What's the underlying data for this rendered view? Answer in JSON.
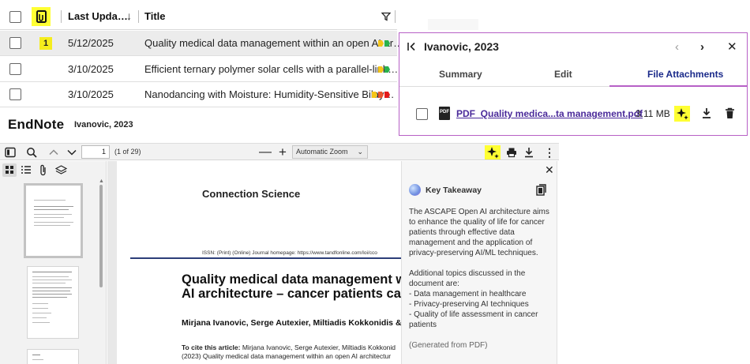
{
  "table": {
    "headers": {
      "last_updated": "Last Upda…",
      "title": "Title"
    },
    "rows": [
      {
        "badge": "1",
        "date": "5/12/2025",
        "title": "Quality medical data management within an open AI ar…",
        "tag_colors": [
          "#f5c518",
          "#2bb24c"
        ]
      },
      {
        "badge": "",
        "date": "3/10/2025",
        "title": "Efficient ternary polymer solar cells with a parallel-link…",
        "tag_colors": [
          "#f5c518",
          "#2bb24c"
        ]
      },
      {
        "badge": "",
        "date": "3/10/2025",
        "title": "Nanodancing with Moisture: Humidity-Sensitive Bilay…",
        "tag_colors": [
          "#f5c518",
          "#e8542e",
          "#e41b1b"
        ]
      }
    ]
  },
  "app": {
    "brand": "EndNote",
    "reference": "Ivanovic, 2023"
  },
  "pdf_toolbar": {
    "page_input": "1",
    "page_count": "(1 of 29)",
    "zoom": "Automatic Zoom"
  },
  "pdf_page": {
    "journal": "Connection Science",
    "issn_line": "ISSN: (Print) (Online) Journal homepage: https://www.tandfonline.com/loi/cco",
    "title_line1": "Quality medical data management wit",
    "title_line2": "AI architecture – cancer patients case",
    "authors": "Mirjana Ivanovic, Serge Autexier, Miltiadis Kokkonidis & Jo",
    "cite_label": "To cite this article:",
    "cite_text": " Mirjana Ivanovic, Serge Autexier, Miltiadis Kokkonid",
    "cite_line2": "(2023) Quality medical data management within an open AI architectur"
  },
  "takeaway": {
    "title": "Key Takeaway",
    "summary": "The ASCAPE Open AI architecture aims to enhance the quality of life for cancer patients through effective data management and the application of privacy-preserving AI/ML techniques.",
    "topics_intro": "Additional topics discussed in the document are:",
    "topics": [
      "- Data management in healthcare",
      "- Privacy-preserving AI techniques",
      "- Quality of life assessment in cancer patients"
    ],
    "footer": "(Generated from PDF)"
  },
  "panel": {
    "title": "Ivanovic, 2023",
    "tabs": [
      "Summary",
      "Edit",
      "File Attachments"
    ],
    "active_tab": "File Attachments",
    "file": {
      "type_label": "PDF",
      "name": "PDF_Quality medica...ta management.pdf",
      "size": "3.11 MB"
    },
    "colors": {
      "accent": "#b760c6",
      "link": "#4a2a9a",
      "highlight": "#ffff33"
    }
  }
}
